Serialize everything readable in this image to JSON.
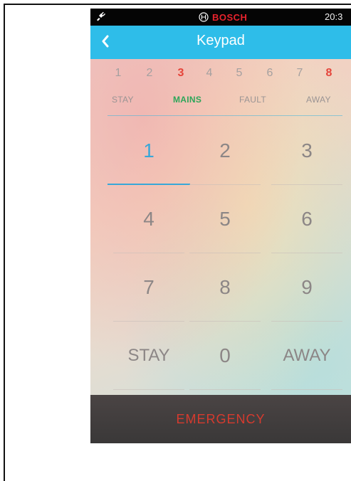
{
  "status_bar": {
    "brand": "BOSCH",
    "clock": "20:3",
    "plug_icon": "plug-icon",
    "brand_icon": "bosch-logo-icon"
  },
  "nav": {
    "title": "Keypad",
    "back_icon": "chevron-left-icon"
  },
  "zones": [
    {
      "label": "1",
      "alert": false
    },
    {
      "label": "2",
      "alert": false
    },
    {
      "label": "3",
      "alert": true
    },
    {
      "label": "4",
      "alert": false
    },
    {
      "label": "5",
      "alert": false
    },
    {
      "label": "6",
      "alert": false
    },
    {
      "label": "7",
      "alert": false
    },
    {
      "label": "8",
      "alert": true
    }
  ],
  "statuses": [
    {
      "label": "STAY",
      "active": false
    },
    {
      "label": "MAINS",
      "active": true
    },
    {
      "label": "FAULT",
      "active": false
    },
    {
      "label": "AWAY",
      "active": false
    }
  ],
  "keypad": {
    "selected_key": "1",
    "keys": [
      "1",
      "2",
      "3",
      "4",
      "5",
      "6",
      "7",
      "8",
      "9",
      "STAY",
      "0",
      "AWAY"
    ]
  },
  "emergency": {
    "label": "EMERGENCY"
  },
  "colors": {
    "nav_background": "#2ebde9",
    "alert": "#e5443a",
    "active_status": "#2ea65a",
    "selected_key": "#38a7d8",
    "emergency_text": "#d63a2e",
    "brand_red": "#e8232d"
  }
}
